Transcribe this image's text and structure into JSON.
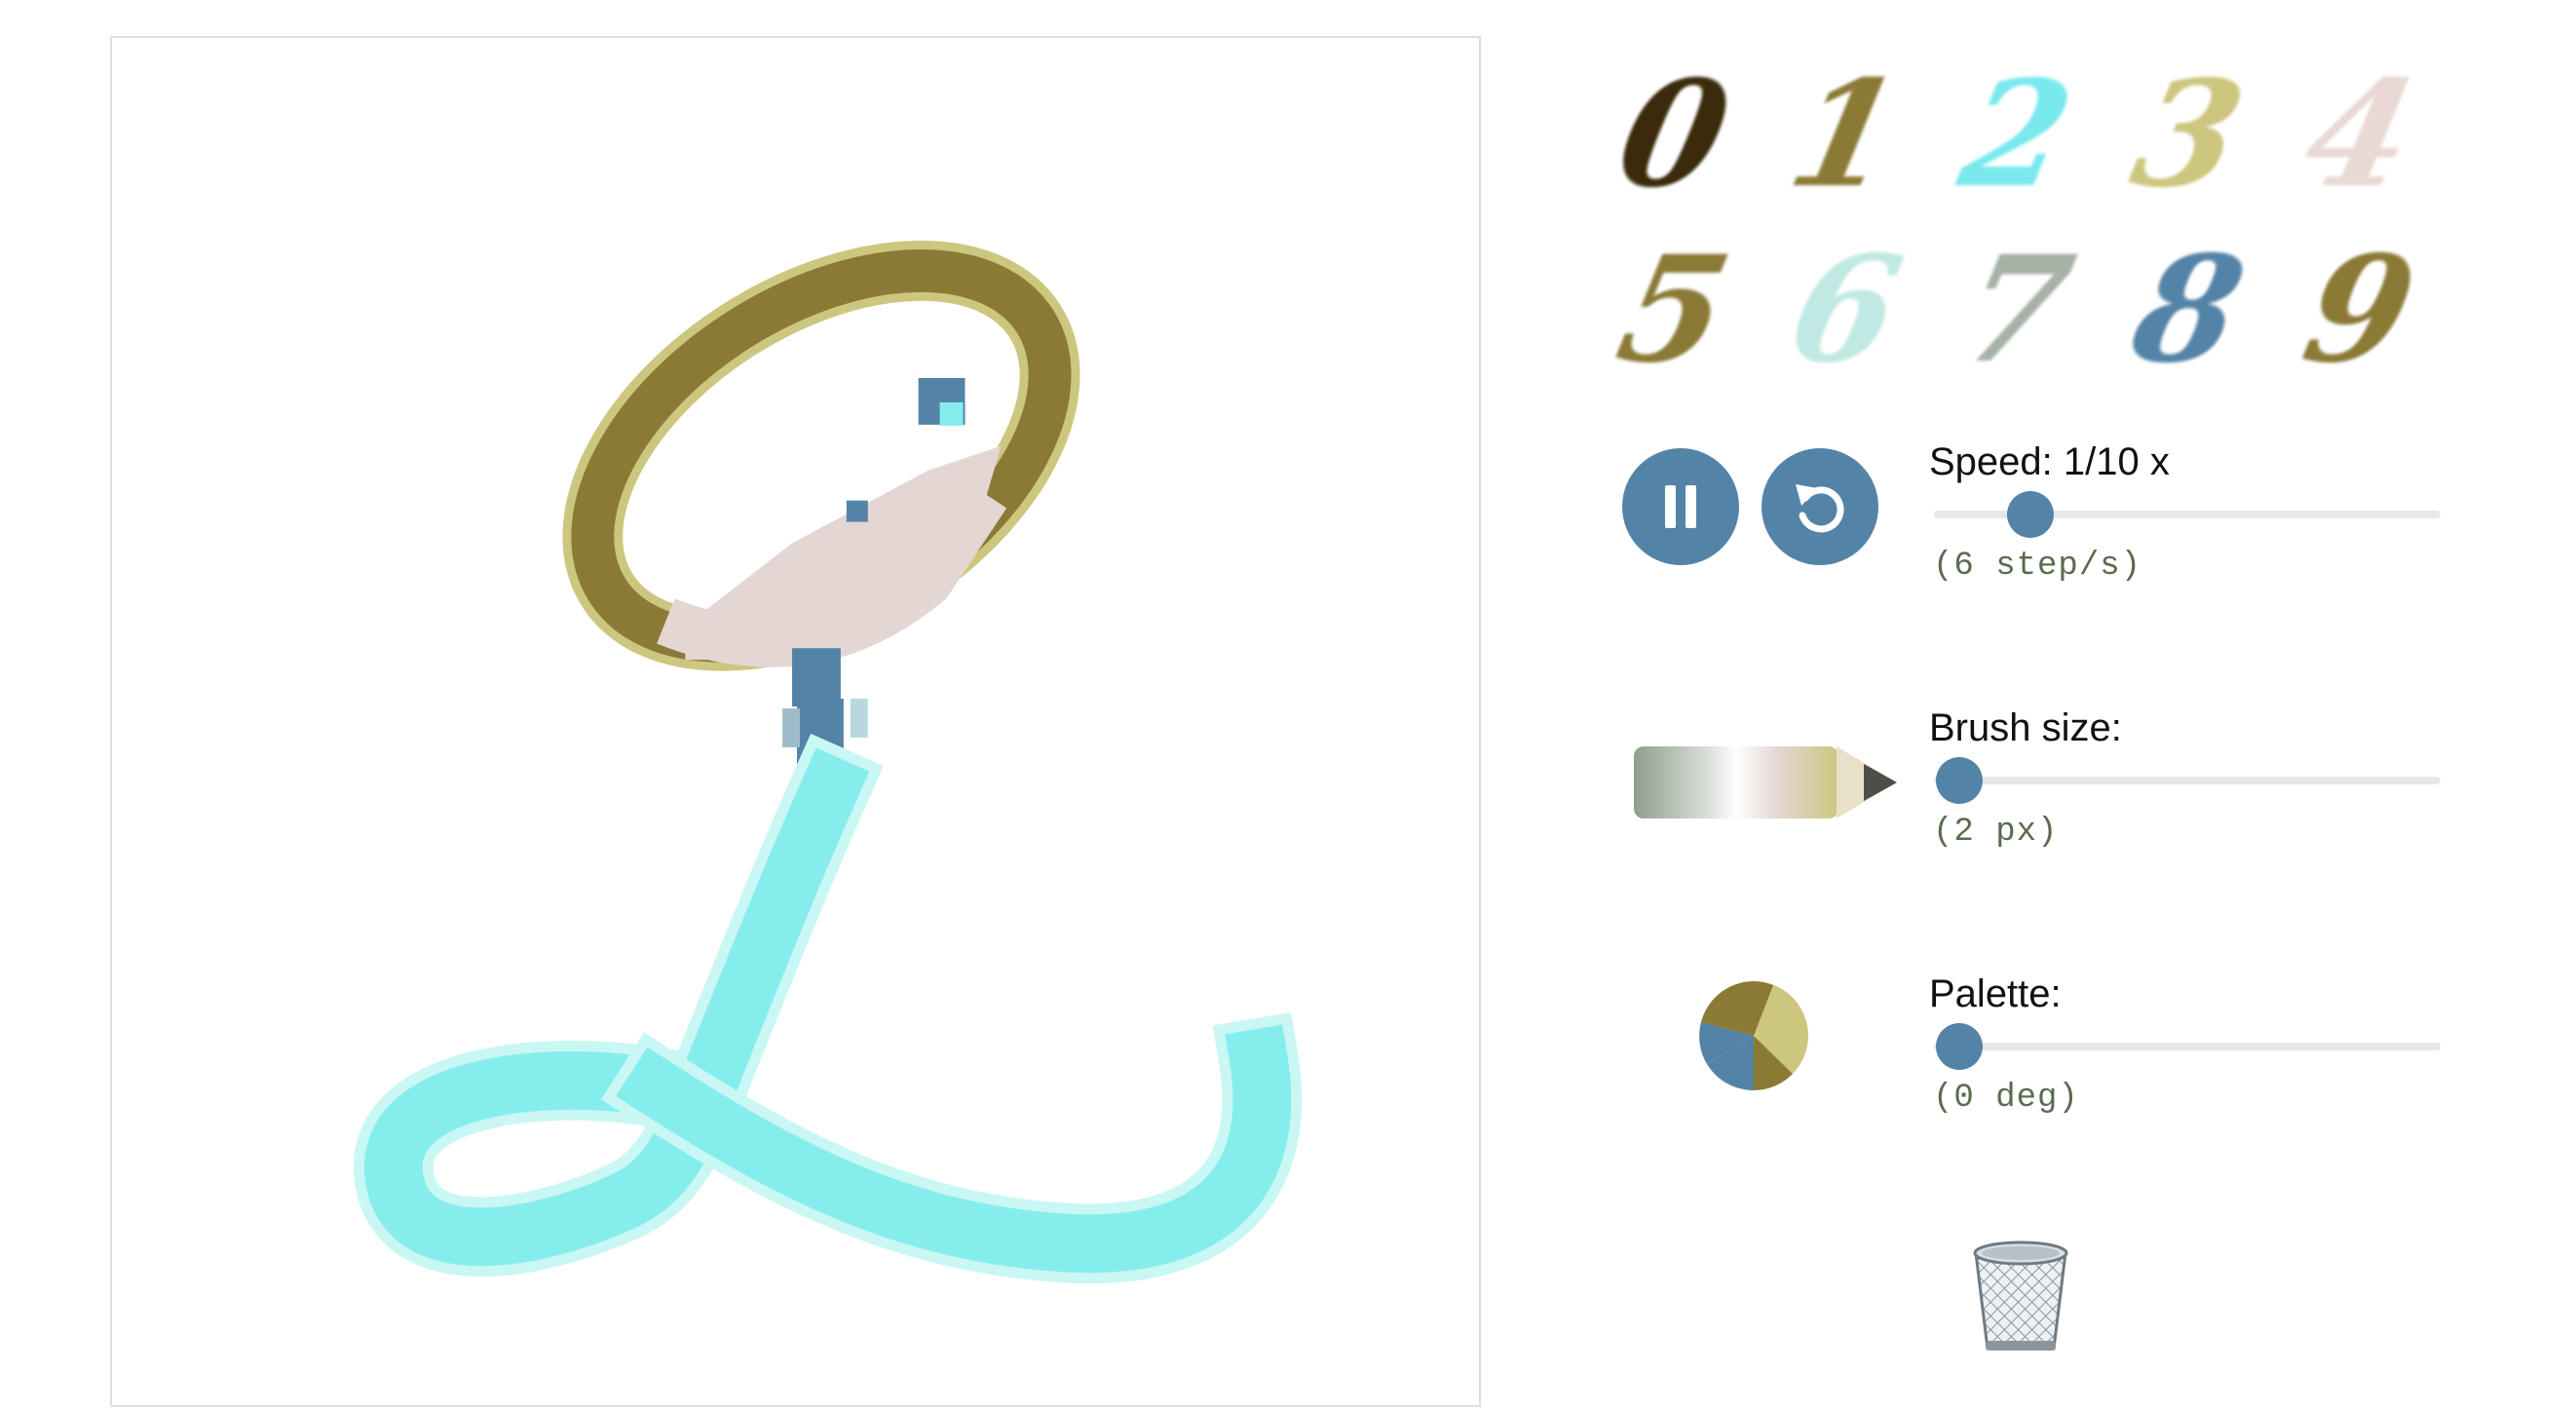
{
  "canvas": {
    "stroke_colors": {
      "olive": "#8b7a36",
      "khaki": "#cdc67f",
      "blush": "#e4d6d2",
      "steel": "#5483a8",
      "aqua": "#86eded",
      "light_aqua": "#c9f7f4"
    }
  },
  "digits": [
    {
      "label": "0",
      "color": "#3b2b0c"
    },
    {
      "label": "1",
      "color": "#8b7a36"
    },
    {
      "label": "2",
      "color": "#7ae9ee"
    },
    {
      "label": "3",
      "color": "#cdc67f"
    },
    {
      "label": "4",
      "color": "#e9d8d3"
    },
    {
      "label": "5",
      "color": "#8b7a36"
    },
    {
      "label": "6",
      "color": "#bfe9e2"
    },
    {
      "label": "7",
      "color": "#a6b2a6"
    },
    {
      "label": "8",
      "color": "#5483a8"
    },
    {
      "label": "9",
      "color": "#8b7a36"
    }
  ],
  "controls": {
    "pause_icon": "pause-icon",
    "restart_icon": "restart-icon",
    "speed": {
      "label": "Speed: 1/10 x",
      "sub": "(6 step/s)",
      "value_fraction": 0.19
    },
    "brush": {
      "label": "Brush size:",
      "sub": "(2 px)",
      "icon": "pencil-icon",
      "value_fraction": 0.05
    },
    "palette": {
      "label": "Palette:",
      "sub": "(0 deg)",
      "icon": "palette-pie-icon",
      "value_fraction": 0.05
    },
    "trash_icon": "trash-icon"
  },
  "colors": {
    "accent": "#5483a8",
    "track": "#e9e7e6",
    "sub_text": "#5a6b4f"
  }
}
